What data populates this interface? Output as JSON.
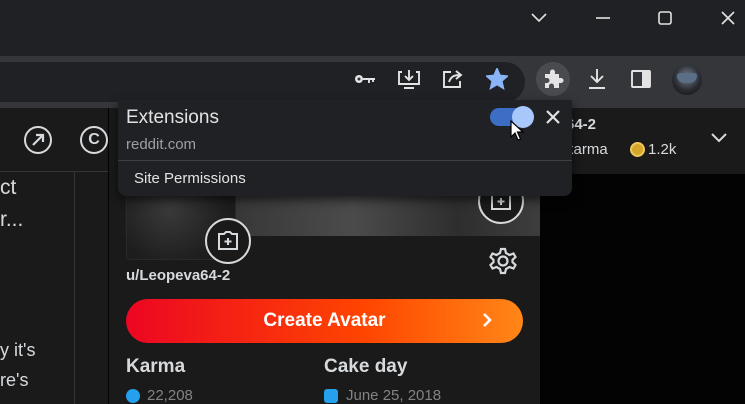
{
  "browser": {
    "window_controls": [
      "minimize",
      "maximize",
      "close"
    ],
    "toolbar_icons": [
      "key-icon",
      "install-icon",
      "share-icon",
      "star-icon",
      "extensions-icon",
      "download-icon",
      "side-panel-icon",
      "profile-avatar"
    ],
    "accent": "#8ab4f8"
  },
  "extensions_popup": {
    "title": "Extensions",
    "domain": "reddit.com",
    "site_permissions": "Site Permissions",
    "toggle_on": true
  },
  "left_panel": {
    "line1": "ct",
    "line2": "r...",
    "line3": "y it's",
    "line4": "re's"
  },
  "profile_header": {
    "username": "64-2",
    "karma_label": "karma",
    "karma_count": "1.2k"
  },
  "profile_card": {
    "username": "u/Leopeva64-2",
    "create_avatar_label": "Create Avatar",
    "karma_label": "Karma",
    "karma_value": "22,208",
    "cake_day_label": "Cake day",
    "cake_day_value": "June 25, 2018"
  }
}
